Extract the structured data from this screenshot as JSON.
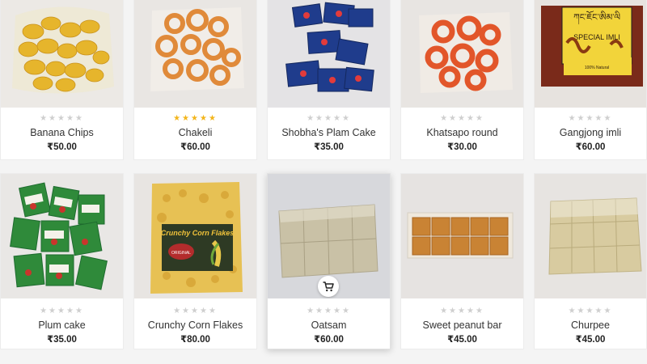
{
  "products": [
    {
      "name": "Banana Chips",
      "price": "₹50.00",
      "rating": 0,
      "stars": "★★★★★"
    },
    {
      "name": "Chakeli",
      "price": "₹60.00",
      "rating": 5,
      "stars": "★★★★★"
    },
    {
      "name": "Shobha's Plam Cake",
      "price": "₹35.00",
      "rating": 0,
      "stars": "★★★★★"
    },
    {
      "name": "Khatsapo round",
      "price": "₹30.00",
      "rating": 0,
      "stars": "★★★★★"
    },
    {
      "name": "Gangjong imli",
      "price": "₹60.00",
      "rating": 0,
      "stars": "★★★★★"
    },
    {
      "name": "Plum cake",
      "price": "₹35.00",
      "rating": 0,
      "stars": "★★★★★"
    },
    {
      "name": "Crunchy Corn Flakes",
      "price": "₹80.00",
      "rating": 0,
      "stars": "★★★★★"
    },
    {
      "name": "Oatsam",
      "price": "₹60.00",
      "rating": 0,
      "stars": "★★★★★"
    },
    {
      "name": "Sweet peanut bar",
      "price": "₹45.00",
      "rating": 0,
      "stars": "★★★★★"
    },
    {
      "name": "Churpee",
      "price": "₹45.00",
      "rating": 0,
      "stars": "★★★★★"
    }
  ],
  "package_text": {
    "gangjong_label_top": "ཀང་ཇོང་ཨིམ་ལི",
    "gangjong_label": "SPECIAL IMLI",
    "gangjong_small": "100% Natural",
    "cornflakes_label": "Crunchy Corn Flakes",
    "cornflakes_badge": "ORIGINAL"
  },
  "icons": {
    "cart_button": "shopping-cart-icon"
  },
  "colors": {
    "star_filled": "#f3b51b",
    "star_empty": "#cfcfcf",
    "price": "#222222",
    "name": "#333333"
  }
}
